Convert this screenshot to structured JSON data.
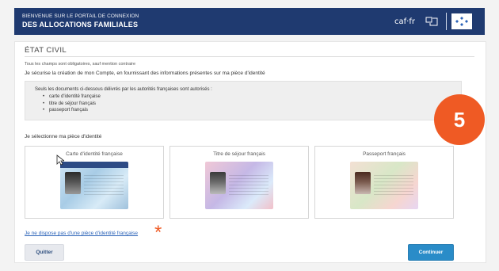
{
  "header": {
    "line1": "BIENVENUE SUR LE PORTAIL DE CONNEXION",
    "line2": "DES ALLOCATIONS FAMILIALES",
    "caf": "caf·fr",
    "brand_color": "#1f3a70"
  },
  "page": {
    "section_title": "ÉTAT CIVIL",
    "note": "Tous les champs sont obligatoires, sauf mention contraire",
    "intro": "Je sécurise la création de mon Compte, en fournissant des informations présentes sur ma pièce d'identité",
    "info": {
      "lead": "Seuls les documents ci-dessous délivrés par les autorités françaises sont autorisés :",
      "items": [
        "carte d'identité française",
        "titre de séjour français",
        "passeport français"
      ]
    },
    "select_label": "Je sélectionne ma pièce d'identité",
    "docs": [
      {
        "label": "Carte d'identité française",
        "icon": "id-card-image"
      },
      {
        "label": "Titre de séjour français",
        "icon": "residence-permit-image"
      },
      {
        "label": "Passeport français",
        "icon": "passport-image"
      }
    ],
    "no_id_link": "Je ne dispose pas d'une pièce d'identité française",
    "buttons": {
      "quit": "Quitter",
      "continue": "Continuer"
    }
  },
  "overlay": {
    "step_number": "5",
    "accent_color": "#ef5a24",
    "asterisk": "*"
  }
}
